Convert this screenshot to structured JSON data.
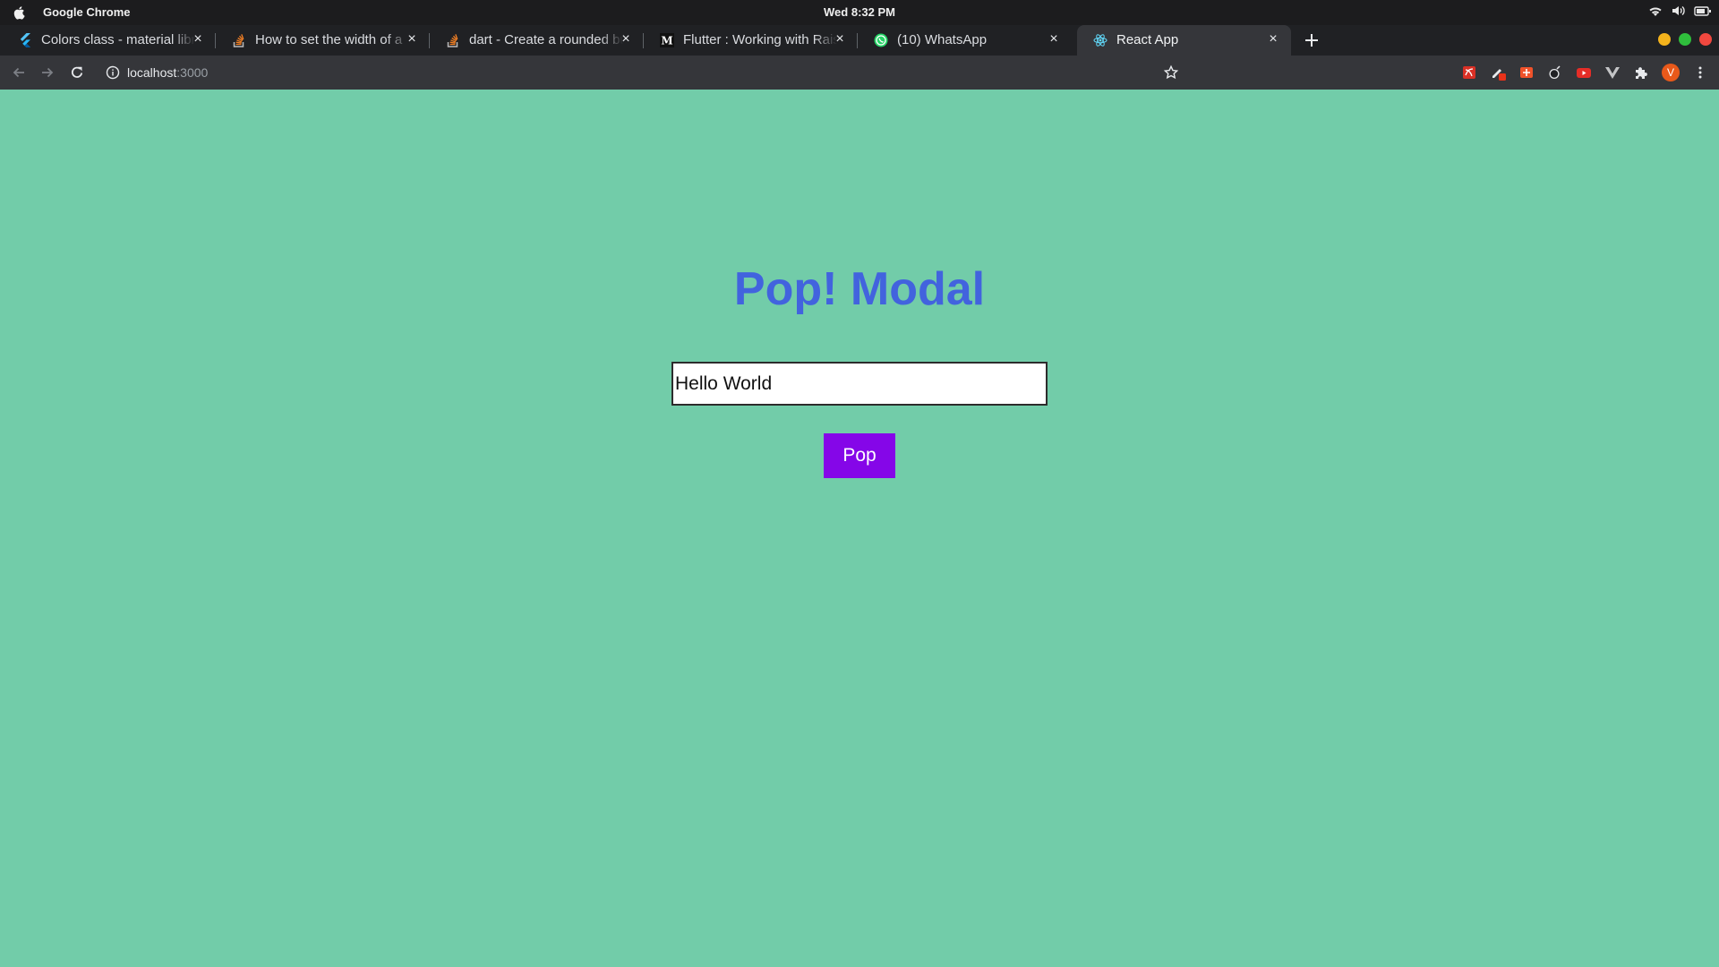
{
  "os": {
    "app_name": "Google Chrome",
    "clock": "Wed  8:32 PM"
  },
  "tabs": [
    {
      "title": "Colors class - material library",
      "favicon": "flutter-icon"
    },
    {
      "title": "How to set the width of a",
      "favicon": "stackoverflow-icon"
    },
    {
      "title": "dart - Create a rounded button",
      "favicon": "stackoverflow-icon"
    },
    {
      "title": "Flutter : Working with Raised",
      "favicon": "medium-icon"
    },
    {
      "title": "(10) WhatsApp",
      "favicon": "whatsapp-icon"
    },
    {
      "title": "React App",
      "favicon": "react-icon",
      "active": true
    }
  ],
  "toolbar": {
    "url_host": "localhost",
    "url_port": ":3000",
    "avatar_letter": "V"
  },
  "page": {
    "heading": "Pop! Modal",
    "input_value": "Hello World",
    "button_label": "Pop"
  },
  "colors": {
    "page_background": "#72cca9",
    "heading": "#4263de",
    "button": "#8506e8",
    "avatar": "#e8591a"
  }
}
